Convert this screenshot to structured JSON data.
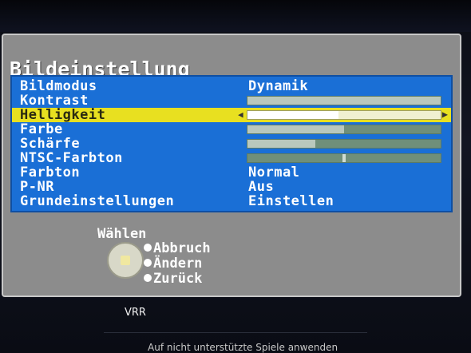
{
  "osd": {
    "title": "Bildeinstellung",
    "rows": [
      {
        "label": "Bildmodus",
        "value": "Dynamik"
      },
      {
        "label": "Kontrast",
        "level": 1.0
      },
      {
        "label": "Helligkeit",
        "level": 0.47,
        "selected": true
      },
      {
        "label": "Farbe",
        "level": 0.5
      },
      {
        "label": "Schärfe",
        "level": 0.35
      },
      {
        "label": "NTSC-Farbton",
        "level": 0.5
      },
      {
        "label": "Farbton",
        "value": "Normal"
      },
      {
        "label": "P-NR",
        "value": "Aus"
      },
      {
        "label": "Grundeinstellungen",
        "value": "Einstellen"
      }
    ],
    "help": {
      "title": "Wählen",
      "items": [
        "Abbruch",
        "Ändern",
        "Zurück"
      ]
    }
  },
  "below": {
    "vrr_label": "VRR",
    "hint": "Auf nicht unterstützte Spiele anwenden"
  },
  "colors": {
    "menu_bg": "#1a6fd6",
    "selected_bg": "#e8e020",
    "panel_bg": "#8c8c8c"
  }
}
